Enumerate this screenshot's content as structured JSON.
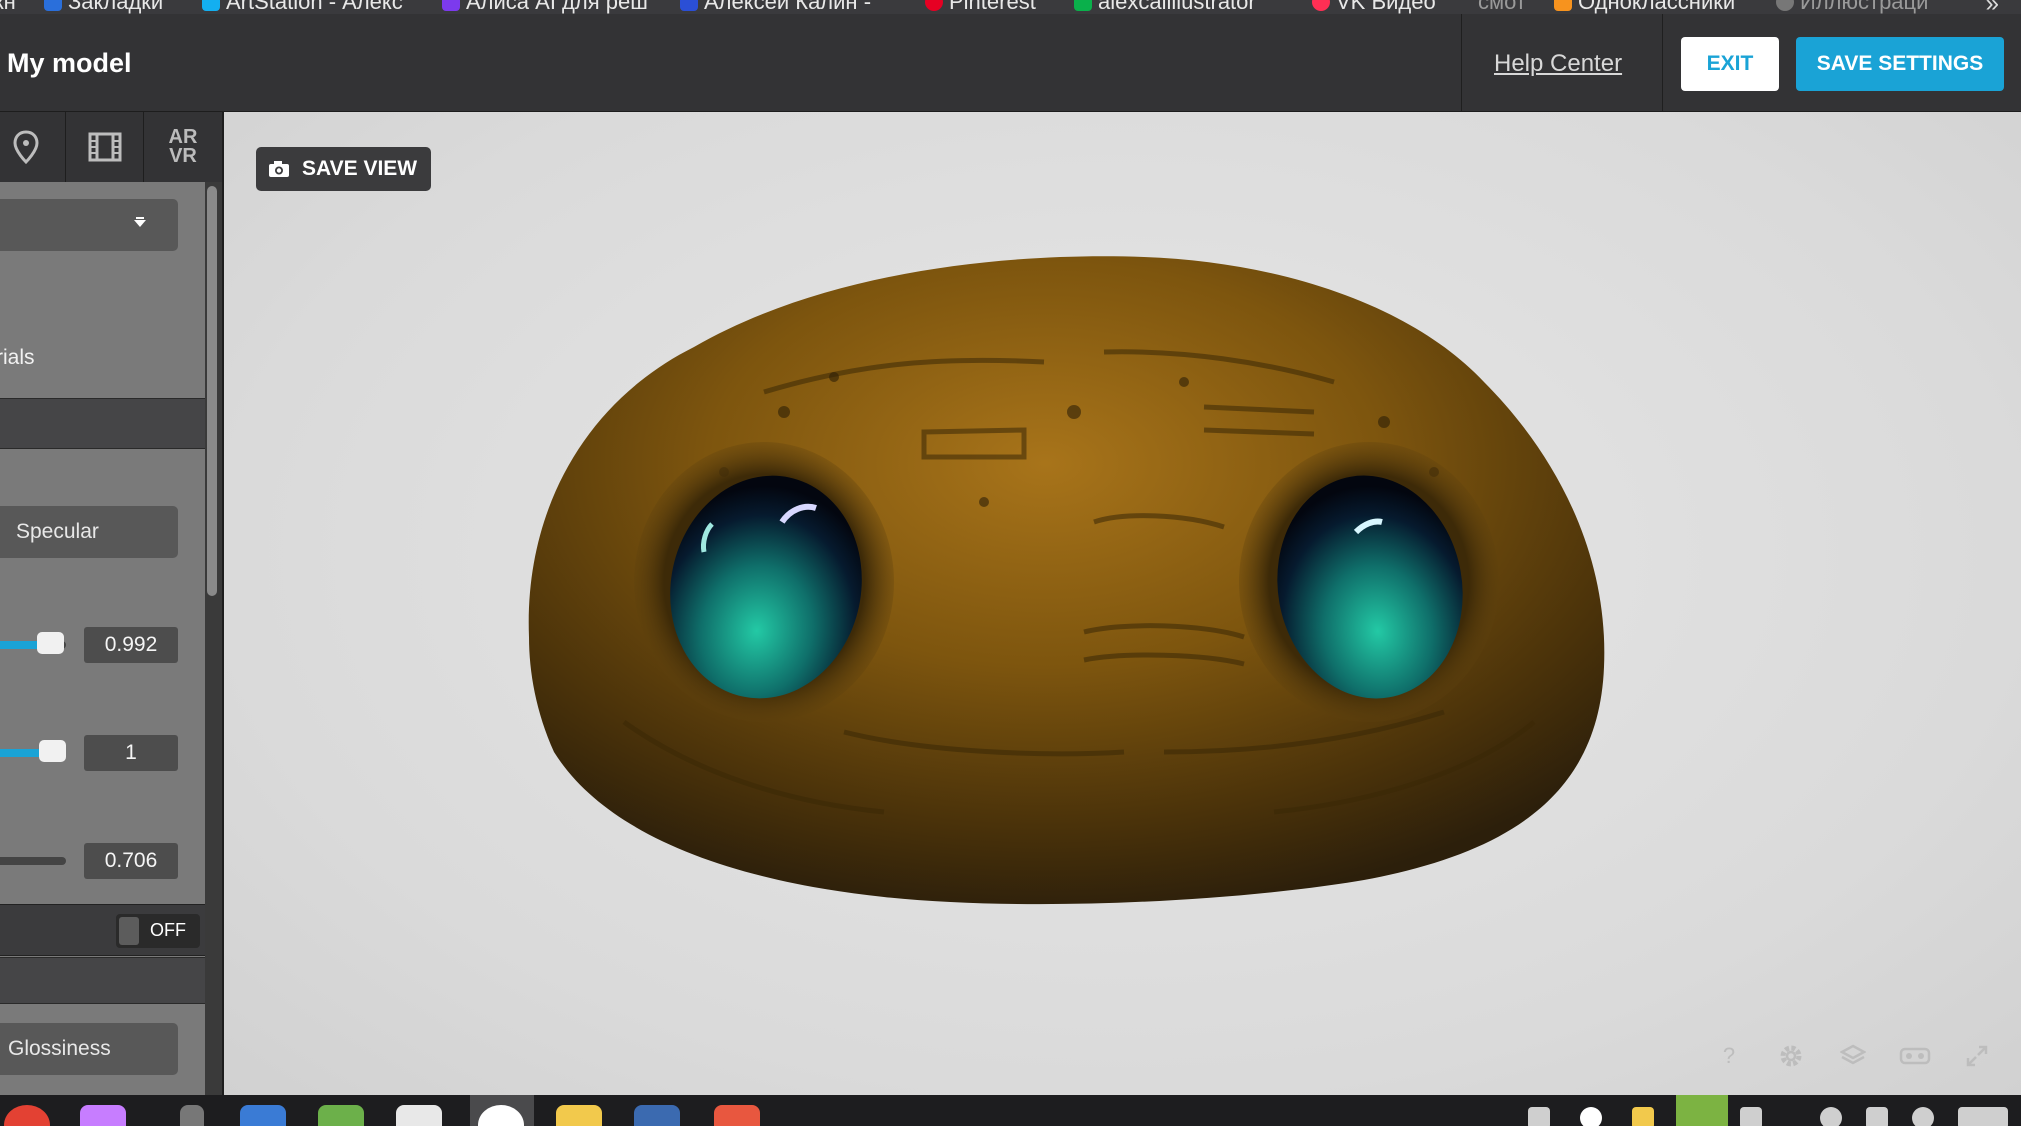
{
  "bookmarks": [
    {
      "label": "кн",
      "color": "#444"
    },
    {
      "label": "Закладки",
      "color": "#2a6fdb"
    },
    {
      "label": "ArtStation - Алекс",
      "color": "#13aff0"
    },
    {
      "label": "Алиса AI для реш",
      "color": "#7c3aed"
    },
    {
      "label": "Алексей Калин -",
      "color": "#2b4fd6"
    },
    {
      "label": "Pinterest",
      "color": "#e60023"
    },
    {
      "label": "alexcalillustrator",
      "color": "#0ab04b"
    },
    {
      "label": "VK Видео",
      "color": "#ff2f54"
    },
    {
      "label": "смот",
      "color": "#555"
    },
    {
      "label": "Одноклассники",
      "color": "#f7931e"
    },
    {
      "label": "Иллюстраци",
      "color": "#888"
    }
  ],
  "header": {
    "title": "My model",
    "help_label": "Help Center",
    "exit_label": "EXIT",
    "save_label": "SAVE SETTINGS"
  },
  "panel": {
    "tabs": [
      "location-pin-icon",
      "film-icon",
      "AR VR"
    ],
    "ar_label_top": "AR",
    "ar_label_bottom": "VR",
    "texts": {
      "line1": "l",
      "line2": "rials"
    },
    "specular_field": "Specular",
    "slider1_value": "0.992",
    "slider1_fraction": 0.992,
    "slider2_value": "1",
    "slider2_fraction": 1,
    "slider3_value": "0.706",
    "toggle_label": "OFF",
    "glossiness_field": "Glossiness"
  },
  "viewport": {
    "save_view_label": "SAVE VIEW",
    "tools": [
      "help-icon",
      "settings-icon",
      "layers-icon",
      "vr-glasses-icon",
      "fullscreen-icon"
    ]
  },
  "colors": {
    "accent": "#1aa3d6",
    "model_base": "#7a5208",
    "eye": "#1fb89b"
  }
}
